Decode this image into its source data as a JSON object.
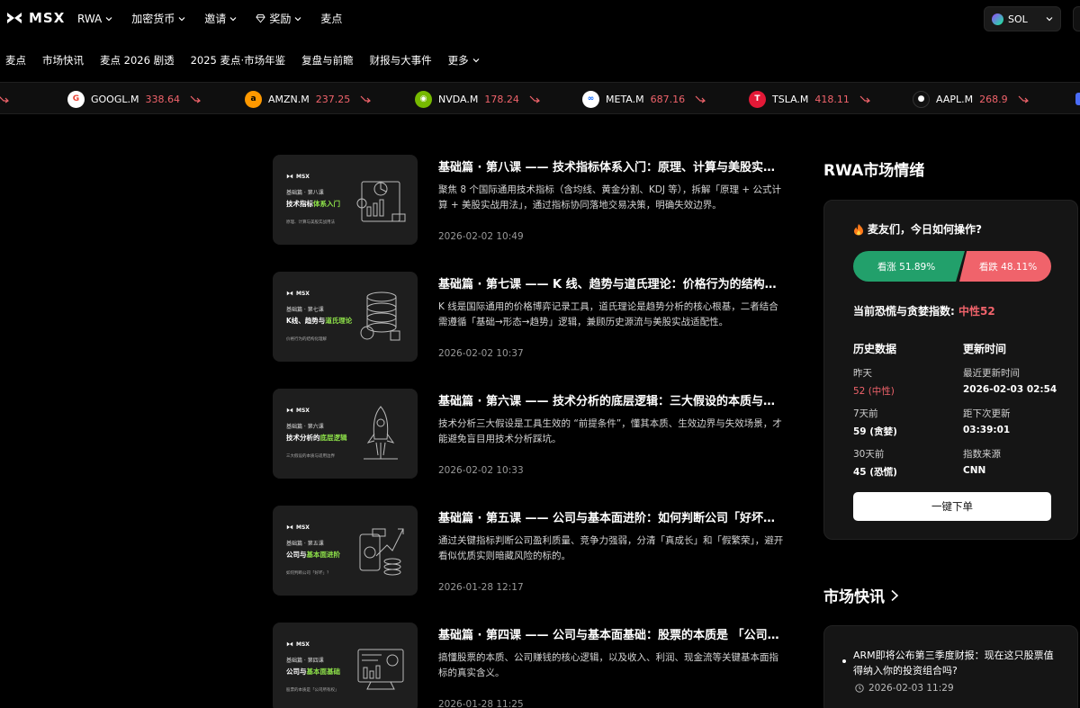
{
  "brand": {
    "name": "MSX"
  },
  "nav": [
    {
      "label": "RWA",
      "has_dropdown": true
    },
    {
      "label": "加密货币",
      "has_dropdown": true
    },
    {
      "label": "邀请",
      "has_dropdown": true
    },
    {
      "label": "奖励",
      "has_dropdown": true,
      "icon": "diamond-icon"
    },
    {
      "label": "麦点",
      "has_dropdown": false
    }
  ],
  "wallet": {
    "chain": "SOL",
    "icon": "solana-icon"
  },
  "subnav": [
    {
      "label": "麦点"
    },
    {
      "label": "市场快讯"
    },
    {
      "label": "麦点 2026 剧透"
    },
    {
      "label": "2025 麦点·市场年鉴"
    },
    {
      "label": "复盘与前瞻"
    },
    {
      "label": "财报与大事件"
    },
    {
      "label": "更多",
      "has_dropdown": true
    }
  ],
  "ticker": [
    {
      "symbol": "GOOGL.M",
      "price": "338.64",
      "trend": "down",
      "logo": "google-logo"
    },
    {
      "symbol": "AMZN.M",
      "price": "237.25",
      "trend": "down",
      "logo": "amazon-logo"
    },
    {
      "symbol": "NVDA.M",
      "price": "178.24",
      "trend": "down",
      "logo": "nvidia-logo"
    },
    {
      "symbol": "META.M",
      "price": "687.16",
      "trend": "down",
      "logo": "meta-logo"
    },
    {
      "symbol": "TSLA.M",
      "price": "418.11",
      "trend": "down",
      "logo": "tesla-logo"
    },
    {
      "symbol": "AAPL.M",
      "price": "268.9",
      "trend": "down",
      "logo": "apple-logo"
    }
  ],
  "articles": [
    {
      "title": "基础篇 · 第八课 —— 技术指标体系入门：原理、计算与美股实战用法",
      "desc": "聚焦 8 个国际通用技术指标（含均线、黄金分割、KDJ 等），拆解「原理 + 公式计算 + 美股实战用法」，通过指标协同落地交易决策，明确失效边界。",
      "time": "2026-02-02 10:49",
      "thumb": {
        "brand": "MSX",
        "sub": "基础篇 · 第八课",
        "title_plain": "技术指标",
        "title_hl": "体系入门",
        "tag": "原理、计算与美股实战用法"
      }
    },
    {
      "title": "基础篇 · 第七课 —— K 线、趋势与道氏理论：价格行为的结构化理解",
      "desc": "K 线是国际通用的价格博弈记录工具，道氏理论是趋势分析的核心根基，二者结合需遵循「基础→形态→趋势」逻辑，兼顾历史源流与美股实战适配性。",
      "time": "2026-02-02 10:37",
      "thumb": {
        "brand": "MSX",
        "sub": "基础篇 · 第七课",
        "title_plain": "K线、趋势与",
        "title_hl": "道氏理论",
        "tag": "价格行为的结构化理解"
      }
    },
    {
      "title": "基础篇 · 第六课 —— 技术分析的底层逻辑：三大假设的本质与边界",
      "desc": "技术分析三大假设是工具生效的 “前提条件”，懂其本质、生效边界与失效场景，才能避免盲目用技术分析踩坑。",
      "time": "2026-02-02 10:33",
      "thumb": {
        "brand": "MSX",
        "sub": "基础篇 · 第六课",
        "title_plain": "技术分析的",
        "title_hl": "底层逻辑",
        "tag": "三大假设的本质与适用边界"
      }
    },
    {
      "title": "基础篇 · 第五课 —— 公司与基本面进阶：如何判断公司「好坏」？",
      "desc": "通过关键指标判断公司盈利质量、竞争力强弱，分清「真成长」和「假繁荣」，避开看似优质实则暗藏风险的标的。",
      "time": "2026-01-28 12:17",
      "thumb": {
        "brand": "MSX",
        "sub": "基础篇 · 第五课",
        "title_plain": "公司与",
        "title_hl": "基本面进阶",
        "tag": "如何判断公司「好坏」？"
      }
    },
    {
      "title": "基础篇 · 第四课 —— 公司与基本面基础：股票的本质是 「公司所有权」",
      "desc": "搞懂股票的本质、公司赚钱的核心逻辑，以及收入、利润、现金流等关键基本面指标的真实含义。",
      "time": "2026-01-28 11:25",
      "thumb": {
        "brand": "MSX",
        "sub": "基础篇 · 第四课",
        "title_plain": "公司与",
        "title_hl": "基本面基础",
        "tag": "股票的本质是「公司所有权」"
      }
    }
  ],
  "rwa": {
    "section_title": "RWA市场情绪",
    "question": "麦友们，今日如何操作?",
    "up_label": "看涨 51.89%",
    "down_label": "看跌 48.11%",
    "up_ratio": 0.5189,
    "fg_label": "当前恐慌与贪婪指数:",
    "fg_value": "中性52",
    "history_header": "历史数据",
    "update_header": "更新时间",
    "rows": [
      {
        "l_label": "昨天",
        "l_value": "52 (中性)",
        "r_label": "最近更新时间",
        "r_value": "2026-02-03 02:54"
      },
      {
        "l_label": "7天前",
        "l_value": "59 (贪婪)",
        "r_label": "距下次更新",
        "r_value": "03:39:01"
      },
      {
        "l_label": "30天前",
        "l_value": "45 (恐慌)",
        "r_label": "指数来源",
        "r_value": "CNN"
      }
    ],
    "order_button": "一键下单"
  },
  "news": {
    "section_title": "市场快讯",
    "items": [
      {
        "text": "ARM即将公布第三季度财报：现在这只股票值得纳入你的投资组合吗?",
        "time": "2026-02-03 11:29"
      }
    ]
  },
  "colors": {
    "up": "#22a06b",
    "down": "#f0636b",
    "highlight": "#8fe34a"
  }
}
